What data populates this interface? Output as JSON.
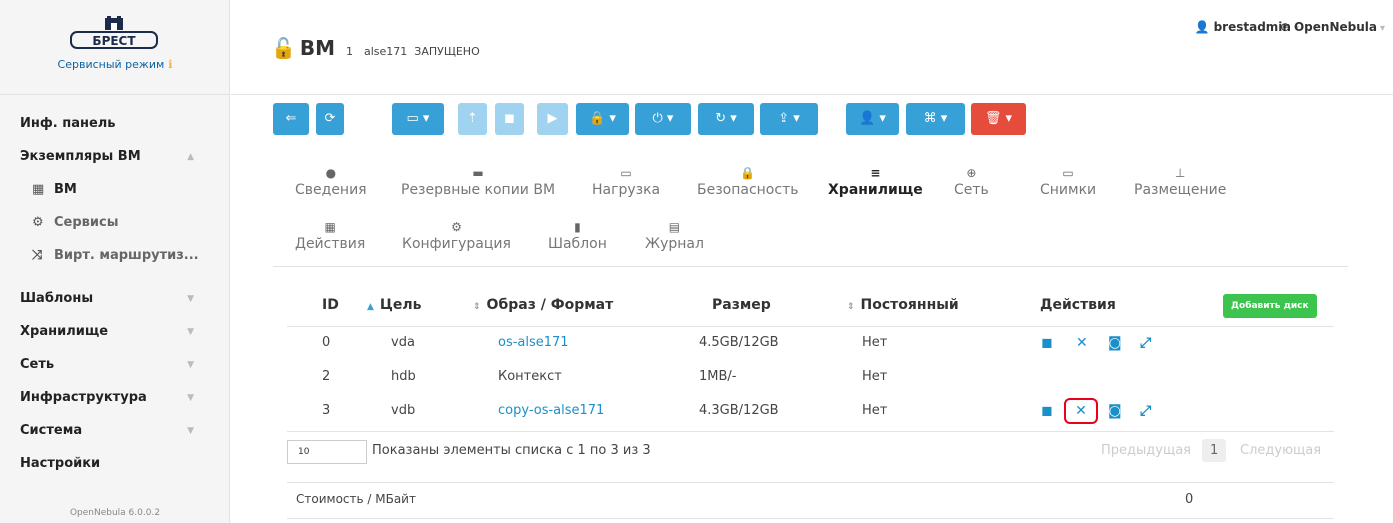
{
  "logo": {
    "brand": "БРЕСТ",
    "mode": "Сервисный режим"
  },
  "sidebar": {
    "items": [
      {
        "label": "Инф. панель"
      },
      {
        "label": "Экземпляры ВМ"
      },
      {
        "label": "ВМ"
      },
      {
        "label": "Сервисы"
      },
      {
        "label": "Вирт. маршрутиз..."
      },
      {
        "label": "Шаблоны"
      },
      {
        "label": "Хранилище"
      },
      {
        "label": "Сеть"
      },
      {
        "label": "Инфраструктура"
      },
      {
        "label": "Система"
      },
      {
        "label": "Настройки"
      }
    ],
    "version": "OpenNebula 6.0.0.2"
  },
  "header": {
    "title": "ВМ",
    "vm_id": "1",
    "vm_name": "alse171",
    "state": "ЗАПУЩЕНО",
    "user": "brestadmin",
    "cloud": "OpenNebula"
  },
  "tabs": [
    {
      "label": "Сведения"
    },
    {
      "label": "Резервные копии ВМ"
    },
    {
      "label": "Нагрузка"
    },
    {
      "label": "Безопасность"
    },
    {
      "label": "Хранилище",
      "active": true
    },
    {
      "label": "Сеть"
    },
    {
      "label": "Снимки"
    },
    {
      "label": "Размещение"
    },
    {
      "label": "Действия"
    },
    {
      "label": "Конфигурация"
    },
    {
      "label": "Шаблон"
    },
    {
      "label": "Журнал"
    }
  ],
  "table": {
    "headers": {
      "id": "ID",
      "target": "Цель",
      "image": "Образ / Формат",
      "size": "Размер",
      "persistent": "Постоянный",
      "actions": "Действия"
    },
    "add_disk": "Добавить диск",
    "rows": [
      {
        "id": "0",
        "target": "vda",
        "image": "os-alse171",
        "image_link": true,
        "size": "4.5GB/12GB",
        "persistent": "Нет",
        "has_actions": true
      },
      {
        "id": "2",
        "target": "hdb",
        "image": "Контекст",
        "image_link": false,
        "size": "1MB/-",
        "persistent": "Нет",
        "has_actions": false
      },
      {
        "id": "3",
        "target": "vdb",
        "image": "copy-os-alse171",
        "image_link": true,
        "size": "4.3GB/12GB",
        "persistent": "Нет",
        "has_actions": true
      }
    ]
  },
  "pagination": {
    "page_length": "10",
    "info": "Показаны элементы списка с 1 по 3 из 3",
    "prev": "Предыдущая",
    "current": "1",
    "next": "Следующая"
  },
  "cost": {
    "label": "Стоимость / МБайт",
    "value": "0"
  }
}
